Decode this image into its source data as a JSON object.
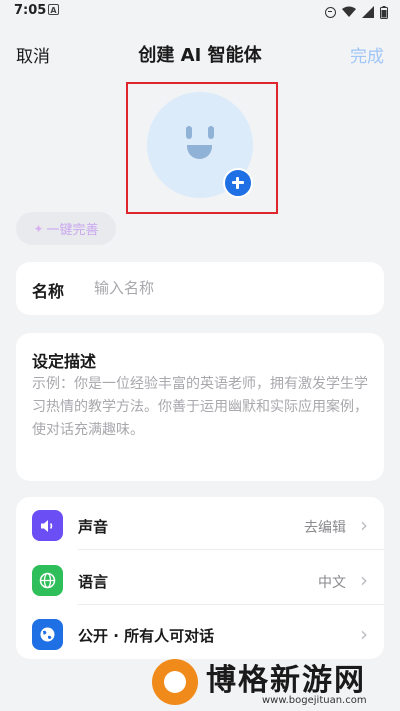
{
  "status_bar": {
    "time": "7:05",
    "notification_badge": "A"
  },
  "nav": {
    "cancel": "取消",
    "title": "创建 AI 智能体",
    "done": "完成",
    "done_color": "#9fc6f8"
  },
  "avatar": {
    "icon": "smiley-face-icon",
    "add_icon": "plus-icon",
    "add_color": "#1f6fe5"
  },
  "magic_button": {
    "icon": "magic-wand-icon",
    "label": "一键完善"
  },
  "name_field": {
    "label": "名称",
    "placeholder": "输入名称",
    "value": ""
  },
  "description": {
    "title": "设定描述",
    "placeholder": "示例：你是一位经验丰富的英语老师，拥有激发学生学习热情的教学方法。你善于运用幽默和实际应用案例，使对话充满趣味。"
  },
  "settings": [
    {
      "icon": "speaker-icon",
      "icon_color": "#6c4ef5",
      "label": "声音",
      "value": "去编辑"
    },
    {
      "icon": "globe-icon",
      "icon_color": "#2fbf5a",
      "label": "语言",
      "value": "中文"
    },
    {
      "icon": "earth-icon",
      "icon_color": "#1f6fe5",
      "label": "公开 · 所有人可对话",
      "value": ""
    }
  ],
  "watermark": {
    "text": "博格新游网",
    "url": "www.bogejituan.com"
  }
}
